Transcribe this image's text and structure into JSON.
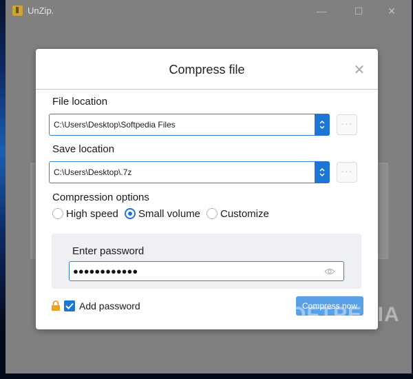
{
  "window": {
    "title": "UnZip."
  },
  "dialog": {
    "title": "Compress file",
    "file_location": {
      "label": "File location",
      "value": "C:\\Users\\Desktop\\Softpedia Files",
      "browse_label": "···"
    },
    "save_location": {
      "label": "Save location",
      "value": "C:\\Users\\Desktop\\.7z",
      "browse_label": "···"
    },
    "compression": {
      "label": "Compression options",
      "options": [
        "High speed",
        "Small volume",
        "Customize"
      ],
      "selected": "Small volume"
    },
    "password": {
      "label": "Enter password",
      "masked_value": "●●●●●●●●●●●●"
    },
    "add_password": {
      "label": "Add password",
      "checked": true
    },
    "compress_button": "Compress now"
  },
  "watermark": "SOFTPEDIA",
  "colors": {
    "accent": "#1f75d3",
    "button": "#5aa0e8",
    "lock": "#f0a020"
  }
}
